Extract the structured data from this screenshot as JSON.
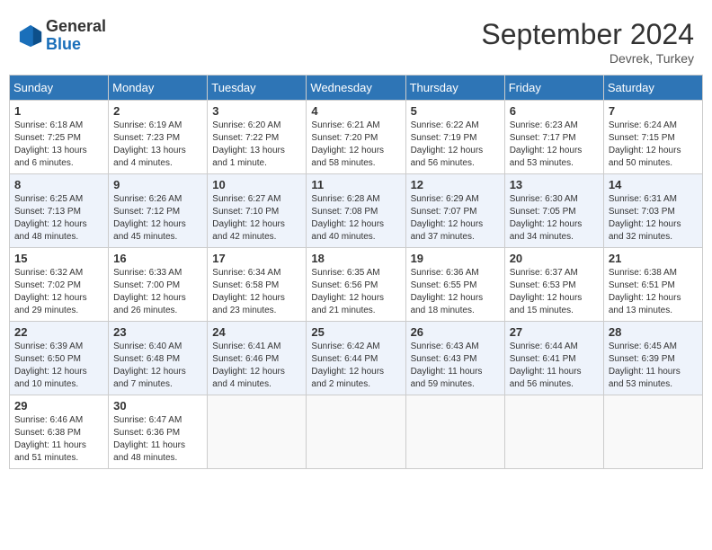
{
  "header": {
    "logo_line1": "General",
    "logo_line2": "Blue",
    "month_title": "September 2024",
    "location": "Devrek, Turkey"
  },
  "weekdays": [
    "Sunday",
    "Monday",
    "Tuesday",
    "Wednesday",
    "Thursday",
    "Friday",
    "Saturday"
  ],
  "weeks": [
    [
      {
        "day": "1",
        "sunrise": "6:18 AM",
        "sunset": "7:25 PM",
        "daylight": "13 hours and 6 minutes."
      },
      {
        "day": "2",
        "sunrise": "6:19 AM",
        "sunset": "7:23 PM",
        "daylight": "13 hours and 4 minutes."
      },
      {
        "day": "3",
        "sunrise": "6:20 AM",
        "sunset": "7:22 PM",
        "daylight": "13 hours and 1 minute."
      },
      {
        "day": "4",
        "sunrise": "6:21 AM",
        "sunset": "7:20 PM",
        "daylight": "12 hours and 58 minutes."
      },
      {
        "day": "5",
        "sunrise": "6:22 AM",
        "sunset": "7:19 PM",
        "daylight": "12 hours and 56 minutes."
      },
      {
        "day": "6",
        "sunrise": "6:23 AM",
        "sunset": "7:17 PM",
        "daylight": "12 hours and 53 minutes."
      },
      {
        "day": "7",
        "sunrise": "6:24 AM",
        "sunset": "7:15 PM",
        "daylight": "12 hours and 50 minutes."
      }
    ],
    [
      {
        "day": "8",
        "sunrise": "6:25 AM",
        "sunset": "7:13 PM",
        "daylight": "12 hours and 48 minutes."
      },
      {
        "day": "9",
        "sunrise": "6:26 AM",
        "sunset": "7:12 PM",
        "daylight": "12 hours and 45 minutes."
      },
      {
        "day": "10",
        "sunrise": "6:27 AM",
        "sunset": "7:10 PM",
        "daylight": "12 hours and 42 minutes."
      },
      {
        "day": "11",
        "sunrise": "6:28 AM",
        "sunset": "7:08 PM",
        "daylight": "12 hours and 40 minutes."
      },
      {
        "day": "12",
        "sunrise": "6:29 AM",
        "sunset": "7:07 PM",
        "daylight": "12 hours and 37 minutes."
      },
      {
        "day": "13",
        "sunrise": "6:30 AM",
        "sunset": "7:05 PM",
        "daylight": "12 hours and 34 minutes."
      },
      {
        "day": "14",
        "sunrise": "6:31 AM",
        "sunset": "7:03 PM",
        "daylight": "12 hours and 32 minutes."
      }
    ],
    [
      {
        "day": "15",
        "sunrise": "6:32 AM",
        "sunset": "7:02 PM",
        "daylight": "12 hours and 29 minutes."
      },
      {
        "day": "16",
        "sunrise": "6:33 AM",
        "sunset": "7:00 PM",
        "daylight": "12 hours and 26 minutes."
      },
      {
        "day": "17",
        "sunrise": "6:34 AM",
        "sunset": "6:58 PM",
        "daylight": "12 hours and 23 minutes."
      },
      {
        "day": "18",
        "sunrise": "6:35 AM",
        "sunset": "6:56 PM",
        "daylight": "12 hours and 21 minutes."
      },
      {
        "day": "19",
        "sunrise": "6:36 AM",
        "sunset": "6:55 PM",
        "daylight": "12 hours and 18 minutes."
      },
      {
        "day": "20",
        "sunrise": "6:37 AM",
        "sunset": "6:53 PM",
        "daylight": "12 hours and 15 minutes."
      },
      {
        "day": "21",
        "sunrise": "6:38 AM",
        "sunset": "6:51 PM",
        "daylight": "12 hours and 13 minutes."
      }
    ],
    [
      {
        "day": "22",
        "sunrise": "6:39 AM",
        "sunset": "6:50 PM",
        "daylight": "12 hours and 10 minutes."
      },
      {
        "day": "23",
        "sunrise": "6:40 AM",
        "sunset": "6:48 PM",
        "daylight": "12 hours and 7 minutes."
      },
      {
        "day": "24",
        "sunrise": "6:41 AM",
        "sunset": "6:46 PM",
        "daylight": "12 hours and 4 minutes."
      },
      {
        "day": "25",
        "sunrise": "6:42 AM",
        "sunset": "6:44 PM",
        "daylight": "12 hours and 2 minutes."
      },
      {
        "day": "26",
        "sunrise": "6:43 AM",
        "sunset": "6:43 PM",
        "daylight": "11 hours and 59 minutes."
      },
      {
        "day": "27",
        "sunrise": "6:44 AM",
        "sunset": "6:41 PM",
        "daylight": "11 hours and 56 minutes."
      },
      {
        "day": "28",
        "sunrise": "6:45 AM",
        "sunset": "6:39 PM",
        "daylight": "11 hours and 53 minutes."
      }
    ],
    [
      {
        "day": "29",
        "sunrise": "6:46 AM",
        "sunset": "6:38 PM",
        "daylight": "11 hours and 51 minutes."
      },
      {
        "day": "30",
        "sunrise": "6:47 AM",
        "sunset": "6:36 PM",
        "daylight": "11 hours and 48 minutes."
      },
      null,
      null,
      null,
      null,
      null
    ]
  ]
}
